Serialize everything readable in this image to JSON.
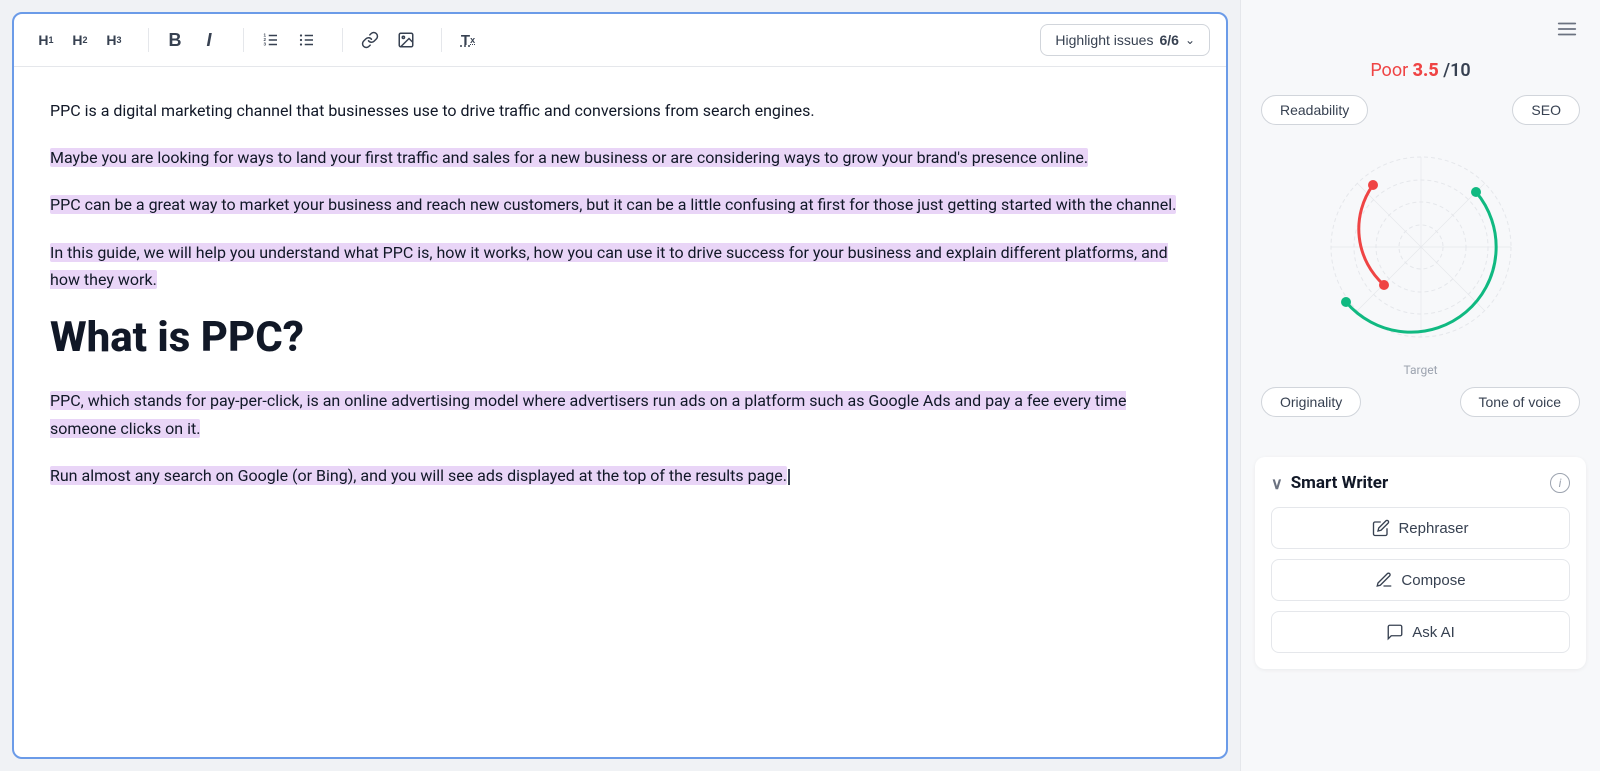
{
  "toolbar": {
    "h1_label": "H",
    "h1_sub": "1",
    "h2_label": "H",
    "h2_sub": "2",
    "h3_label": "H",
    "h3_sub": "3",
    "bold_label": "B",
    "italic_label": "I",
    "highlight_issues_label": "Highlight issues",
    "highlight_count": "6/6",
    "chevron": "⌄"
  },
  "content": {
    "para1": "PPC is a digital marketing channel that businesses use to drive traffic and conversions from search engines.",
    "para2": "Maybe you are looking for ways to land your first traffic and sales for a new business or are considering ways to grow your brand's presence online.",
    "para3": "PPC can be a great way to market your business and reach new customers, but it can be a little confusing at first for those just getting started with the channel.",
    "para4": "In this guide, we will help you understand what PPC is, how it works, how you can use it to drive success for your business and explain different platforms, and how they work.",
    "heading1": "What is PPC?",
    "para5": "PPC, which stands for pay-per-click, is an online advertising model where advertisers run ads on a platform such as Google Ads and pay a fee every time someone clicks on it.",
    "para6": "Run almost any search on Google (or Bing), and you will see ads displayed at the top of the results page."
  },
  "score": {
    "quality_label": "Poor",
    "score_number": "3.5",
    "score_total": "/10"
  },
  "metrics": {
    "readability": "Readability",
    "seo": "SEO",
    "originality": "Originality",
    "tone_of_voice": "Tone of voice",
    "target_label": "Target"
  },
  "smart_writer": {
    "title": "Smart Writer",
    "rephraser_label": "Rephraser",
    "compose_label": "Compose",
    "ask_ai_label": "Ask AI"
  },
  "radar": {
    "circles": 4,
    "red_arc_start_angle": 210,
    "red_arc_end_angle": 310,
    "green_arc_start_angle": 50,
    "green_arc_end_angle": 150
  }
}
